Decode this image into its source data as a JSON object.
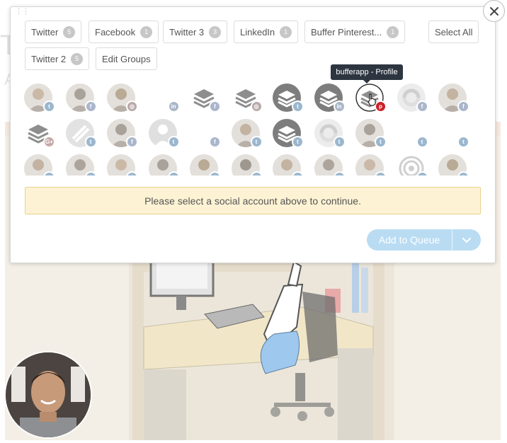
{
  "background": {
    "heading_fragment": "T",
    "sub_fragment": "A"
  },
  "groups": [
    {
      "label": "Twitter",
      "count": "5"
    },
    {
      "label": "Facebook",
      "count": "1"
    },
    {
      "label": "Twitter 3",
      "count": "3"
    },
    {
      "label": "LinkedIn",
      "count": "1"
    },
    {
      "label": "Buffer Pinterest...",
      "count": "1"
    },
    {
      "label": "Twitter 2",
      "count": "5"
    }
  ],
  "select_all_label": "Select All",
  "edit_groups_label": "Edit Groups",
  "tooltip": "bufferapp - Profile",
  "alert": "Please select a social account above to continue.",
  "queue": {
    "label": "Add to Queue"
  },
  "networks": {
    "twitter": {
      "color": "#9bb7cf",
      "icon": "twitter-icon"
    },
    "facebook": {
      "color": "#aab6cc",
      "icon": "facebook-icon"
    },
    "instagram": {
      "color": "#b9a9a9",
      "icon": "instagram-icon"
    },
    "linkedin": {
      "color": "#a9b7c7",
      "icon": "linkedin-icon"
    },
    "pinterest": {
      "color": "#cb2027",
      "icon": "pinterest-icon"
    },
    "googleplus": {
      "color": "#c9a9a9",
      "icon": "google-plus-icon"
    }
  },
  "accounts": [
    {
      "kind": "photo",
      "network": "twitter"
    },
    {
      "kind": "photo",
      "network": "facebook"
    },
    {
      "kind": "photo",
      "network": "instagram"
    },
    {
      "kind": "empty",
      "network": "linkedin"
    },
    {
      "kind": "buffer",
      "network": "facebook"
    },
    {
      "kind": "buffer",
      "network": "instagram"
    },
    {
      "kind": "buffer-dark",
      "network": "twitter"
    },
    {
      "kind": "buffer-dark",
      "network": "linkedin"
    },
    {
      "kind": "buffer-selected",
      "network": "pinterest"
    },
    {
      "kind": "swirl",
      "network": "facebook"
    },
    {
      "kind": "photo",
      "network": "facebook"
    },
    {
      "kind": "buffer",
      "network": "googleplus"
    },
    {
      "kind": "logo",
      "network": "twitter"
    },
    {
      "kind": "photo",
      "network": "facebook"
    },
    {
      "kind": "default",
      "network": "twitter"
    },
    {
      "kind": "empty",
      "network": "facebook"
    },
    {
      "kind": "photo",
      "network": "twitter"
    },
    {
      "kind": "buffer-dark",
      "network": "twitter"
    },
    {
      "kind": "swirl",
      "network": "twitter"
    },
    {
      "kind": "photo",
      "network": "twitter"
    },
    {
      "kind": "empty",
      "network": "twitter"
    },
    {
      "kind": "empty",
      "network": "twitter"
    },
    {
      "kind": "photo",
      "network": "twitter"
    },
    {
      "kind": "photo",
      "network": "twitter"
    },
    {
      "kind": "photo",
      "network": "twitter"
    },
    {
      "kind": "photo",
      "network": "twitter"
    },
    {
      "kind": "photo",
      "network": "twitter"
    },
    {
      "kind": "photo",
      "network": "twitter"
    },
    {
      "kind": "photo",
      "network": "twitter"
    },
    {
      "kind": "photo",
      "network": "twitter"
    },
    {
      "kind": "photo",
      "network": "twitter"
    },
    {
      "kind": "target",
      "network": "twitter"
    },
    {
      "kind": "photo",
      "network": "twitter"
    }
  ]
}
